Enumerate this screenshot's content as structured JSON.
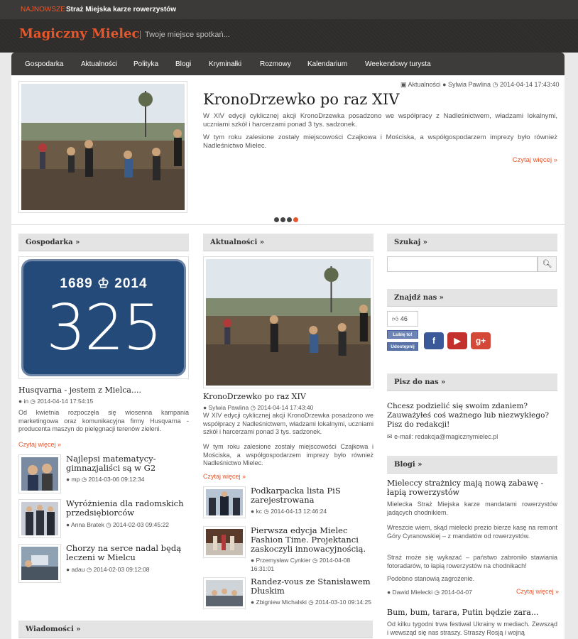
{
  "topbar": {
    "tag": "NAJNOWSZE",
    "headline": "Straż Miejska karze rowerzystów"
  },
  "header": {
    "logo": "Magiczny Mielec",
    "tagline": "Twoje miejsce spotkań..."
  },
  "menu": [
    "Gospodarka",
    "Aktualności",
    "Polityka",
    "Blogi",
    "Kryminałki",
    "Rozmowy",
    "Kalendarium",
    "Weekendowy turysta"
  ],
  "hero": {
    "category": "Aktualności",
    "author": "Sylwia Pawlina",
    "date": "2014-04-14 17:43:40",
    "title": "KronoDrzewko po raz XIV",
    "p1": "W XIV edycji cyklicznej akcji KronoDrzewka posadzono we współpracy z Nadleśnictwem, władzami lokalnymi, uczniami szkół i harcerzami ponad 3 tys. sadzonek.",
    "p2": "W tym roku zalesione zostały miejscowości Czajkowa i Mościska,  a współgospodarzem imprezy było również Nadleśnictwo Mielec.",
    "more": "Czytaj więcej »"
  },
  "gospodarka": {
    "header": "Gospodarka »",
    "badge_years": "1689 ♔ 2014",
    "badge_number": "325",
    "title": "Husqvarna - jestem z Mielca....",
    "author": "in",
    "date": "2014-04-14 17:54:15",
    "text": "Od kwietnia rozpoczęła się wiosenna kampania marketingowa oraz komunikacyjna firmy Husqvarna - producenta maszyn do pielęgnacji terenów zieleni.",
    "more": "Czytaj więcej »",
    "items": [
      {
        "title": "Najlepsi matematycy-gimnazjaliści są w G2",
        "author": "mp",
        "date": "2014-03-06 09:12:34"
      },
      {
        "title": "Wyróżnienia dla radomskich przedsiębiorców",
        "author": "Anna Bratek",
        "date": "2014-02-03 09:45:22"
      },
      {
        "title": "Chorzy na serce nadal będą leczeni w Mielcu",
        "author": "adau",
        "date": "2014-02-03 09:12:08"
      }
    ]
  },
  "aktualnosci": {
    "header": "Aktualności »",
    "title": "KronoDrzewko po raz XIV",
    "author": "Sylwia Pawlina",
    "date": "2014-04-14 17:43:40",
    "p1": "W XIV edycji cyklicznej akcji KronoDrzewka posadzono we współpracy z Nadleśnictwem, władzami lokalnymi, uczniami szkół i harcerzami ponad 3 tys. sadzonek.",
    "p2": "W tym roku zalesione zostały miejscowości Czajkowa i Mościska,  a współgospodarzem imprezy było również Nadleśnictwo Mielec.",
    "more": "Czytaj więcej »",
    "items": [
      {
        "title": "Podkarpacka lista PiS zarejestrowana",
        "author": "kc",
        "date": "2014-04-13 12:46:24"
      },
      {
        "title": "Pierwsza edycja Mielec Fashion Time. Projektanci zaskoczyli innowacyjnością.",
        "author": "Przemysław Cynkier",
        "date": "2014-04-08 16:31:01"
      },
      {
        "title": "Randez-vous ze Stanisławem Dłuskim",
        "author": "Zbigniew Michalski",
        "date": "2014-03-10 09:14:25"
      }
    ]
  },
  "wiadomosci": {
    "header": "Wiadomości »"
  },
  "sidebar": {
    "search_header": "Szukaj »",
    "find_header": "Znajdź nas »",
    "like_count": "46",
    "like_label": "Lubię to!",
    "share_label": "Udostępnij",
    "pisz_header": "Pisz do nas »",
    "pisz_text": "Chcesz podzielić się swoim zdaniem? Zauważyłeś coś ważnego lub niezwykłego? Pisz do redakcji!",
    "email": "e-mail: redakcja@magicznymielec.pl",
    "blogi_header": "Blogi »",
    "blog1": {
      "title": "Mieleccy strażnicy mają nową zabawę - łapią rowerzystów",
      "p1": "Mielecka Straż Miejska karze mandatami rowerzystów jadących chodnikiem.",
      "p2": "Wreszcie wiem, skąd mielecki prezio bierze kasę na remont Góry Cyranowskiej – z mandatów od rowerzystów.",
      "p3": "Straż może się wykazać – państwo zabroniło stawiania fotoradarów, to łapią rowerzystów na chodnikach!",
      "p4": "Podobno stanowią zagrożenie.",
      "author": "Dawid Mielecki",
      "date": "2014-04-07",
      "more": "Czytaj więcej »"
    },
    "blog2": {
      "title": "Bum, bum, tarara, Putin będzie zara...",
      "p1": "Od kilku tygodni trwa festiwal Ukrainy w mediach. Zewsząd i wewsząd się nas straszy. Straszy Rosją i wojną"
    }
  },
  "colors": {
    "accent": "#e8562a",
    "dark": "#3c3a38"
  }
}
